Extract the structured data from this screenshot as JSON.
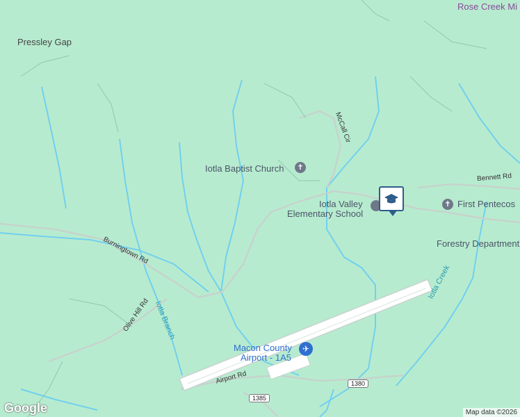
{
  "map": {
    "labels": {
      "rose_creek": "Rose Creek Mi",
      "pressley_gap": "Pressley Gap",
      "mccall_cir": "McCall Cir",
      "iotla_baptist": "Iotla Baptist Church",
      "bennett_rd": "Bennett Rd",
      "iotla_valley": "Iotla Valley",
      "elementary": "Elementary School",
      "first_pentecost": "First Pentecos",
      "forestry": "Forestry Department",
      "burningtown": "Burningtown Rd",
      "olive_hill": "Olive Hill Rd",
      "iotla_branch": "Iotla Branch",
      "iotla_creek": "Iotla Creek",
      "airport_name": "Macon County",
      "airport_code": "Airport - 1A5",
      "airport_rd": "Airport Rd"
    },
    "shields": {
      "s1380": "1380",
      "s1385": "1385"
    },
    "footer": "Map data ©2026",
    "logo": "Google",
    "icons": {
      "church": "cross-icon",
      "school": "school-icon",
      "airport": "airplane-icon",
      "selected_marker": "graduation-cap-icon"
    },
    "colors": {
      "land": "#b7ebcf",
      "water": "#71d0ee",
      "road": "#c6d3cd",
      "accent": "#2d5d8a"
    }
  }
}
